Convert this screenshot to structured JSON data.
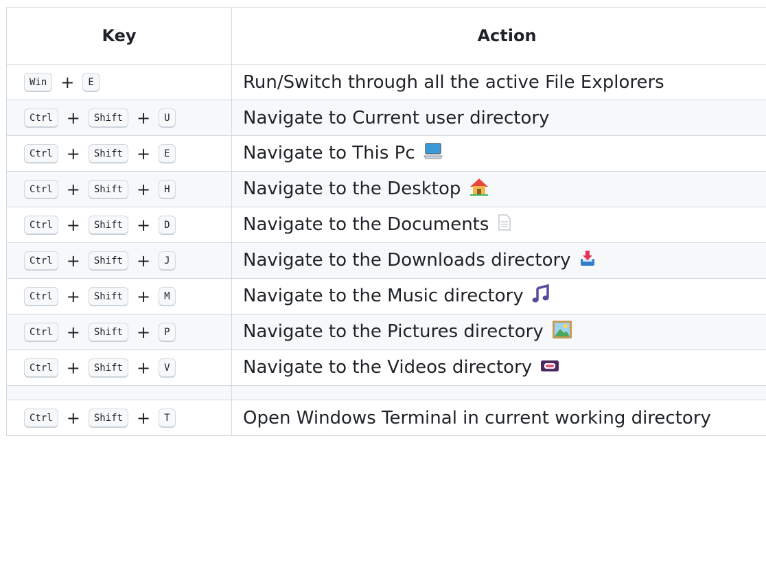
{
  "header": {
    "key": "Key",
    "action": "Action"
  },
  "separator": "+",
  "rows": [
    {
      "keys": [
        "Win",
        "E"
      ],
      "action": "Run/Switch through all the active File Explorers",
      "icon": ""
    },
    {
      "keys": [
        "Ctrl",
        "Shift",
        "U"
      ],
      "action": "Navigate to Current user directory",
      "icon": ""
    },
    {
      "keys": [
        "Ctrl",
        "Shift",
        "E"
      ],
      "action": "Navigate to This Pc",
      "icon": "laptop-icon"
    },
    {
      "keys": [
        "Ctrl",
        "Shift",
        "H"
      ],
      "action": "Navigate to the Desktop",
      "icon": "house-icon"
    },
    {
      "keys": [
        "Ctrl",
        "Shift",
        "D"
      ],
      "action": "Navigate to the Documents",
      "icon": "document-icon"
    },
    {
      "keys": [
        "Ctrl",
        "Shift",
        "J"
      ],
      "action": "Navigate to the Downloads directory",
      "icon": "inbox-tray-icon"
    },
    {
      "keys": [
        "Ctrl",
        "Shift",
        "M"
      ],
      "action": "Navigate to the Music directory",
      "icon": "music-note-icon"
    },
    {
      "keys": [
        "Ctrl",
        "Shift",
        "P"
      ],
      "action": "Navigate to the Pictures directory",
      "icon": "framed-picture-icon"
    },
    {
      "keys": [
        "Ctrl",
        "Shift",
        "V"
      ],
      "action": "Navigate to the Videos directory",
      "icon": "videocassette-icon"
    },
    {
      "keys": [],
      "action": "",
      "icon": ""
    },
    {
      "keys": [
        "Ctrl",
        "Shift",
        "T"
      ],
      "action": "Open Windows Terminal in current working directory",
      "icon": ""
    }
  ],
  "colors": {
    "border": "#d1d9e0",
    "stripe": "#f6f8fa",
    "text": "#1f2328",
    "music": "#5b4a9b"
  }
}
